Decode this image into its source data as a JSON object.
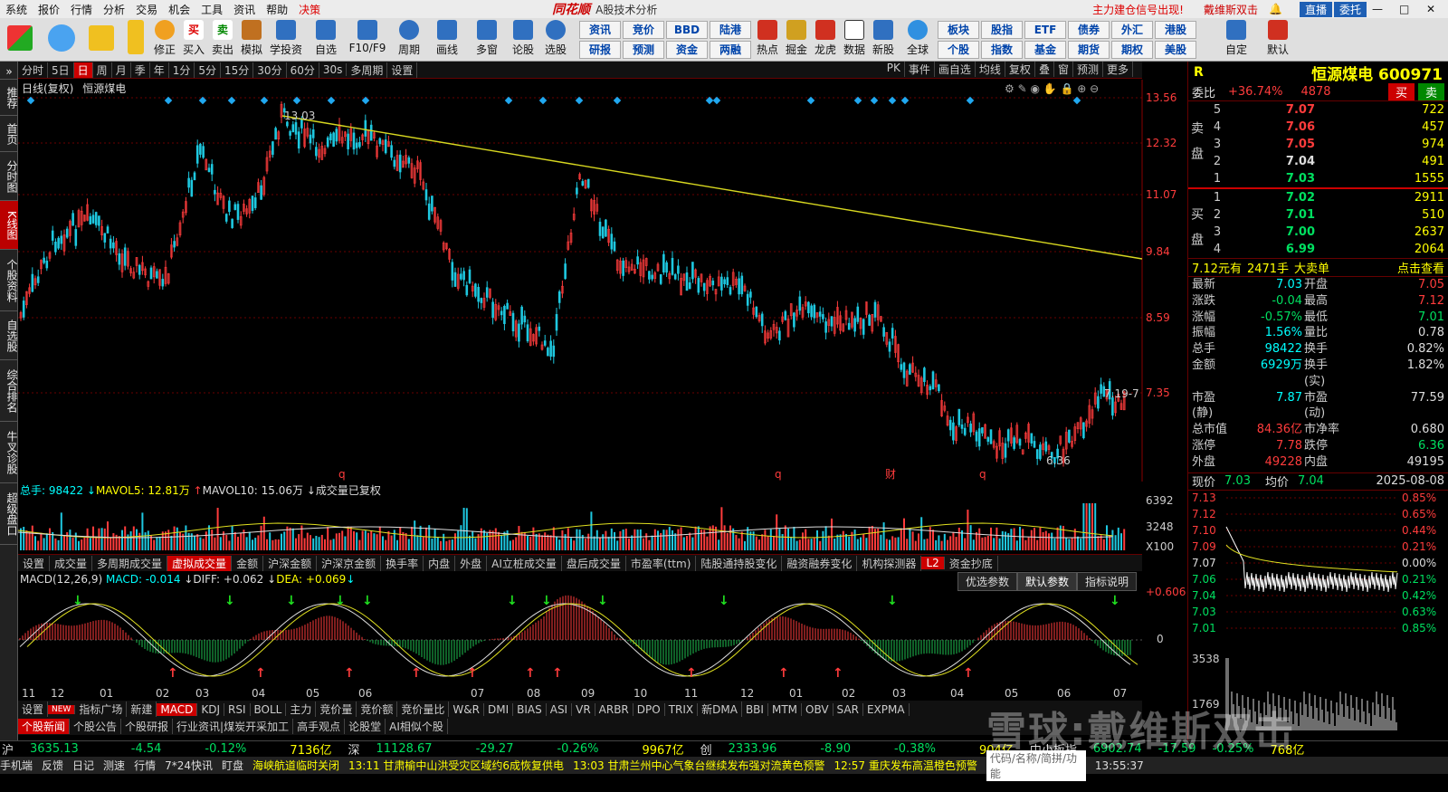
{
  "menu": [
    "系统",
    "报价",
    "行情",
    "分析",
    "交易",
    "机会",
    "工具",
    "资讯",
    "帮助",
    "决策"
  ],
  "app": {
    "logo": "同花顺",
    "subtitle": "A股技术分析"
  },
  "menu_right": {
    "signal": "主力建仓信号出现!",
    "user": "戴维斯双击",
    "direct": "直播",
    "order": "委托"
  },
  "toolbar": [
    "修正",
    "买入",
    "卖出",
    "模拟",
    "学投资",
    "自选",
    "F10/F9",
    "周期",
    "画线",
    "多窗",
    "论股",
    "选股",
    "热点",
    "掘金",
    "龙虎",
    "数据",
    "新股",
    "全球",
    "自定",
    "默认"
  ],
  "toolbar_small": [
    [
      "资讯",
      "竞价",
      "BBD",
      "陆港",
      "板块",
      "股指",
      "ETF",
      "债券",
      "外汇",
      "港股"
    ],
    [
      "研报",
      "预测",
      "资金",
      "两融",
      "个股",
      "指数",
      "基金",
      "期货",
      "期权",
      "美股"
    ]
  ],
  "leftbar": [
    "推荐",
    "首页",
    "分时图",
    "K线图",
    "个股资料",
    "自选股",
    "综合排名",
    "牛叉诊股",
    "超级盘口"
  ],
  "periods": [
    "分时",
    "5日",
    "日",
    "周",
    "月",
    "季",
    "年",
    "1分",
    "5分",
    "15分",
    "30分",
    "60分",
    "30s",
    "多周期",
    "设置"
  ],
  "period_tools": [
    "PK",
    "事件",
    "画自选",
    "均线",
    "复权",
    "叠",
    "窗",
    "预测",
    "更多"
  ],
  "kline": {
    "label": "日线(复权)",
    "name": "恒源煤电",
    "high_label": "13.03",
    "low_label": "6.36",
    "last_label": "7.19-7",
    "price_axis": [
      "13.56",
      "12.32",
      "11.07",
      "9.84",
      "8.59",
      "7.35"
    ],
    "event_marks": [
      "q",
      "q",
      "财",
      "q"
    ]
  },
  "volume": {
    "label": "总手: ",
    "total": "98422",
    "mavol5_label": "MAVOL5: ",
    "mavol5": "12.81万",
    "mavol10_label": "MAVOL10: ",
    "mavol10": "15.06万",
    "note": "成交量已复权",
    "axis": [
      "6392",
      "3248",
      "X100"
    ]
  },
  "ind_tabs": [
    "设置",
    "成交量",
    "多周期成交量",
    "虚拟成交量",
    "金额",
    "沪深金额",
    "沪深京金额",
    "换手率",
    "内盘",
    "外盘",
    "AI立桩成交量",
    "盘后成交量",
    "市盈率(ttm)",
    "陆股通持股变化",
    "融资融券变化",
    "机构探测器",
    "L2",
    "资金抄底"
  ],
  "macd": {
    "label": "MACD(12,26,9)",
    "macd_label": "MACD: ",
    "macd": "-0.014",
    "diff_label": "DIFF: ",
    "diff": "+0.062",
    "dea_label": "DEA: ",
    "dea": "+0.069",
    "axis": [
      "+0.606",
      "0"
    ],
    "btns": [
      "优选参数",
      "默认参数",
      "指标说明"
    ]
  },
  "months": [
    "11",
    "12",
    "01",
    "02",
    "03",
    "04",
    "05",
    "06",
    "07",
    "08",
    "09",
    "10",
    "11",
    "12",
    "01",
    "02",
    "03",
    "04",
    "05",
    "06",
    "07",
    "08"
  ],
  "bottom_tabs": [
    "设置",
    "NEW",
    "指标广场",
    "新建",
    "MACD",
    "KDJ",
    "RSI",
    "BOLL",
    "主力",
    "竞价量",
    "竞价额",
    "竞价量比",
    "W&R",
    "DMI",
    "BIAS",
    "ASI",
    "VR",
    "ARBR",
    "DPO",
    "TRIX",
    "新DMA",
    "BBI",
    "MTM",
    "OBV",
    "SAR",
    "EXPMA"
  ],
  "news_tabs": [
    "个股新闻",
    "个股公告",
    "个股研报",
    "行业资讯|煤炭开采加工",
    "高手观点",
    "论股堂",
    "AI相似个股"
  ],
  "index": {
    "sh": "沪",
    "sh_v": "3635.13",
    "sh_c": "-4.54",
    "sh_p": "-0.12%",
    "sh_a": "7136亿",
    "sz": "深",
    "sz_v": "11128.67",
    "sz_c": "-29.27",
    "sz_p": "-0.26%",
    "sz_a": "9967亿",
    "cy": "创",
    "cy_v": "2333.96",
    "cy_c": "-8.90",
    "cy_p": "-0.38%",
    "cy_a": "904亿",
    "zx": "中小板指",
    "zx_v": "6902.74",
    "zx_c": "-17.59",
    "zx_p": "-0.25%",
    "zx_a": "768亿"
  },
  "ticker": [
    "手机端",
    "反馈",
    "日记",
    "测速",
    "行情",
    "7*24快讯",
    "盯盘",
    "海峡航道临时关闭",
    "13:11 甘肃榆中山洪受灾区域约6成恢复供电",
    "13:03 甘肃兰州中心气象台继续发布强对流黄色预警",
    "12:57 重庆发布高温橙色预警",
    "代码/名称/简拼/功能",
    "13:55:37"
  ],
  "quote": {
    "r": "R",
    "title": "恒源煤电 600971",
    "wb_label": "委比",
    "wb": "+36.74%",
    "wc": "4878",
    "buy": "买",
    "sell": "卖",
    "sell_side": "卖盘",
    "buy_side": "买盘",
    "asks": [
      [
        "5",
        "7.07",
        "722"
      ],
      [
        "4",
        "7.06",
        "457"
      ],
      [
        "3",
        "7.05",
        "974"
      ],
      [
        "2",
        "7.04",
        "491"
      ],
      [
        "1",
        "7.03",
        "1555"
      ]
    ],
    "bids": [
      [
        "1",
        "7.02",
        "2911"
      ],
      [
        "2",
        "7.01",
        "510"
      ],
      [
        "3",
        "7.00",
        "2637"
      ],
      [
        "4",
        "6.99",
        "2064"
      ]
    ],
    "bigorder": [
      "7.12元有",
      "2471手",
      "大卖单",
      "点击查看"
    ],
    "stats": [
      [
        "最新",
        "7.03",
        "开盘",
        "7.05"
      ],
      [
        "涨跌",
        "-0.04",
        "最高",
        "7.12"
      ],
      [
        "涨幅",
        "-0.57%",
        "最低",
        "7.01"
      ],
      [
        "振幅",
        "1.56%",
        "量比",
        "0.78"
      ],
      [
        "总手",
        "98422",
        "换手",
        "0.82%"
      ],
      [
        "金额",
        "6929万",
        "换手(实)",
        "1.82%"
      ],
      [
        "市盈(静)",
        "7.87",
        "市盈(动)",
        "77.59"
      ],
      [
        "总市值",
        "84.36亿",
        "市净率",
        "0.680"
      ],
      [
        "涨停",
        "7.78",
        "跌停",
        "6.36"
      ],
      [
        "外盘",
        "49228",
        "内盘",
        "49195"
      ]
    ],
    "now_label": "现价",
    "now": "7.03",
    "avg_label": "均价",
    "avg": "7.04",
    "date": "2025-08-08",
    "mini_axis_l": [
      "7.13",
      "7.12",
      "7.10",
      "7.09",
      "7.07",
      "7.06",
      "7.04",
      "7.03",
      "7.01"
    ],
    "mini_axis_r": [
      "0.85%",
      "0.65%",
      "0.44%",
      "0.21%",
      "0.00%",
      "0.21%",
      "0.42%",
      "0.63%",
      "0.85%"
    ],
    "mini_vol": [
      "3538",
      "1769"
    ]
  },
  "watermark": "雪球:戴维斯双击",
  "colors": {
    "up": "#ff3c3c",
    "down": "#00e0e0",
    "trend": "#e0e020"
  }
}
